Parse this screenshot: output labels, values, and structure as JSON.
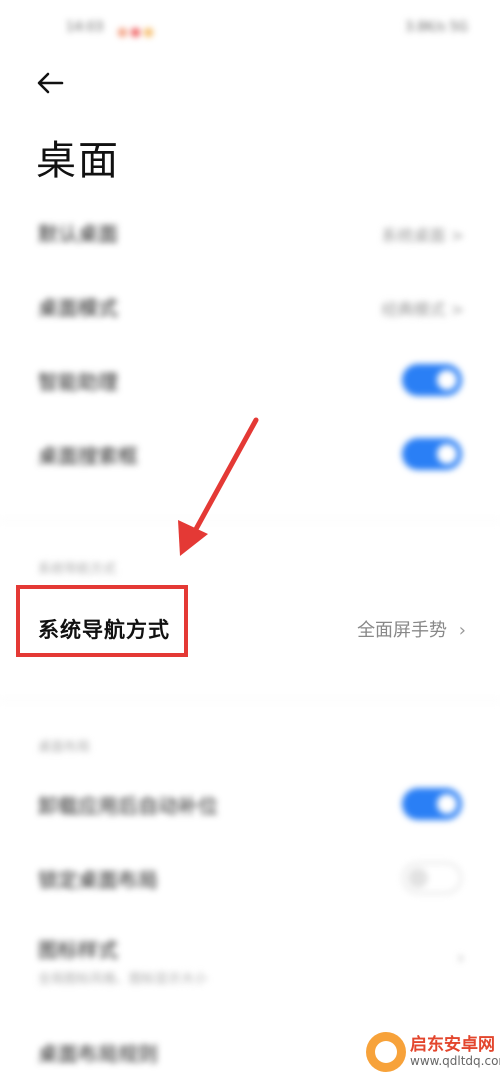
{
  "status_bar": {
    "time": "14:03",
    "right": "3.8K/s 5G"
  },
  "header": {
    "title": "桌面"
  },
  "settings": [
    {
      "label": "默认桌面",
      "value": "系统桌面 >"
    },
    {
      "label": "桌面模式",
      "value": "经典模式 >"
    },
    {
      "label": "智能助理",
      "toggle": "on"
    },
    {
      "label": "桌面搜索框",
      "toggle": "on"
    }
  ],
  "nav_section": {
    "header": "系统导航方式",
    "label": "系统导航方式",
    "value": "全面屏手势"
  },
  "layout_section": {
    "header": "桌面布局",
    "items": [
      {
        "label": "卸载应用后自动补位",
        "toggle": "on"
      },
      {
        "label": "锁定桌面布局",
        "toggle": "off"
      },
      {
        "label": "图标样式",
        "sub": "全局图标风格、图标显示大小"
      },
      {
        "label": "桌面布局规则"
      }
    ]
  },
  "watermark": {
    "name": "启东安卓网",
    "url": "www.qdltdq.com"
  },
  "colors": {
    "accent": "#2a7ff5",
    "annotation_red": "#e43935"
  }
}
